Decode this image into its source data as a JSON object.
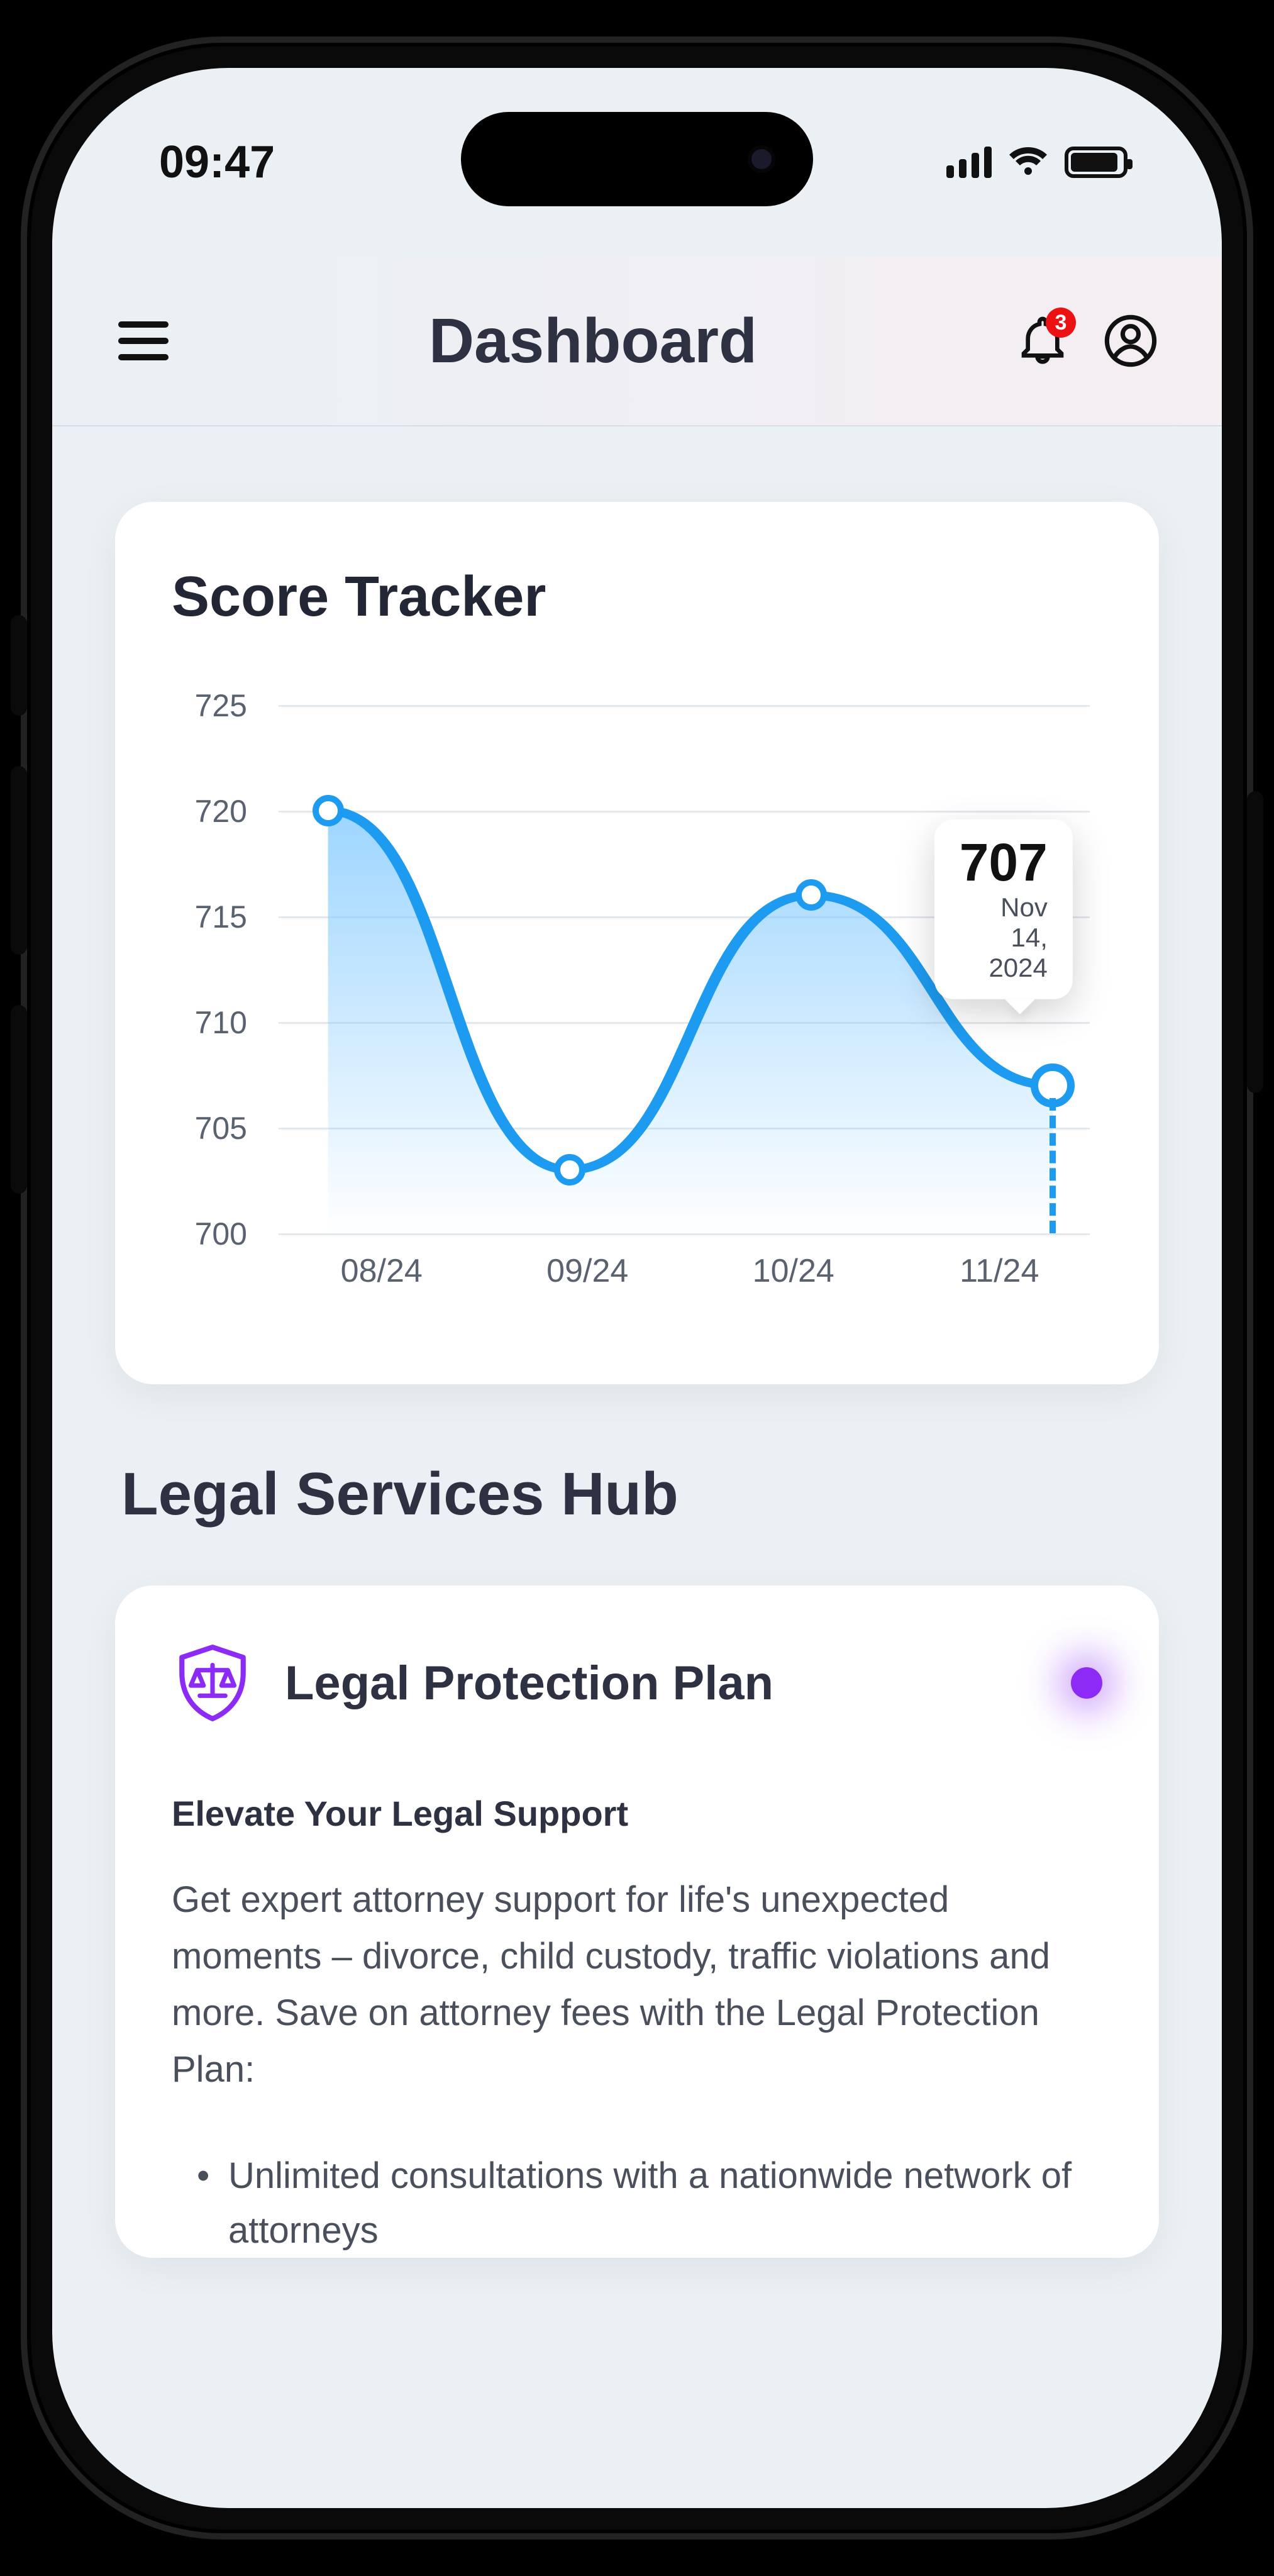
{
  "status": {
    "time": "09:47"
  },
  "header": {
    "title": "Dashboard",
    "notification_count": "3"
  },
  "score_card": {
    "title": "Score Tracker",
    "tooltip_value": "707",
    "tooltip_date": "Nov 14, 2024"
  },
  "legal": {
    "section_title": "Legal Services Hub",
    "card_title": "Legal Protection Plan",
    "subtitle": "Elevate Your Legal Support",
    "body": "Get expert attorney support for life's unexpected moments – divorce, child custody, traffic violations and more. Save on attorney fees with the Legal Protection Plan:",
    "bullets": [
      "Unlimited consultations with a nationwide network of attorneys"
    ]
  },
  "chart_data": {
    "type": "line",
    "title": "Score Tracker",
    "xlabel": "",
    "ylabel": "",
    "ylim": [
      700,
      725
    ],
    "y_ticks": [
      700,
      705,
      710,
      715,
      720,
      725
    ],
    "categories": [
      "08/24",
      "09/24",
      "10/24",
      "11/24"
    ],
    "values": [
      720,
      703,
      716,
      707
    ],
    "highlight": {
      "index": 3,
      "value": 707,
      "date": "Nov 14, 2024"
    }
  }
}
